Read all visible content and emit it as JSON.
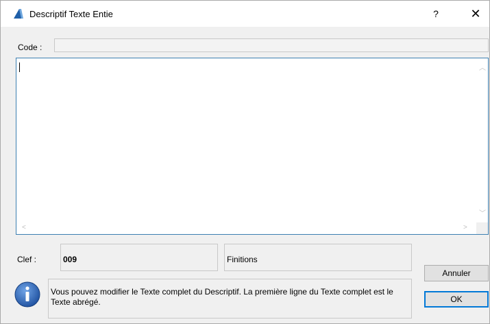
{
  "window": {
    "title": "Descriptif Texte Entie",
    "help_label": "?",
    "close_label": "✕"
  },
  "code": {
    "label": "Code :",
    "value": ""
  },
  "editor": {
    "value": ""
  },
  "clef": {
    "label": "Clef :",
    "value": "009",
    "category": "Finitions"
  },
  "message": {
    "text": "Vous pouvez modifier le Texte complet du Descriptif. La première ligne du Texte complet est le Texte abrégé."
  },
  "buttons": {
    "cancel_label": "Annuler",
    "ok_label": "OK"
  },
  "colors": {
    "accent": "#0078d7",
    "app_icon": "#1f5fa8",
    "info_icon": "#2a64b8"
  },
  "icons": {
    "app": "archicad-app-icon",
    "info": "info-icon"
  }
}
